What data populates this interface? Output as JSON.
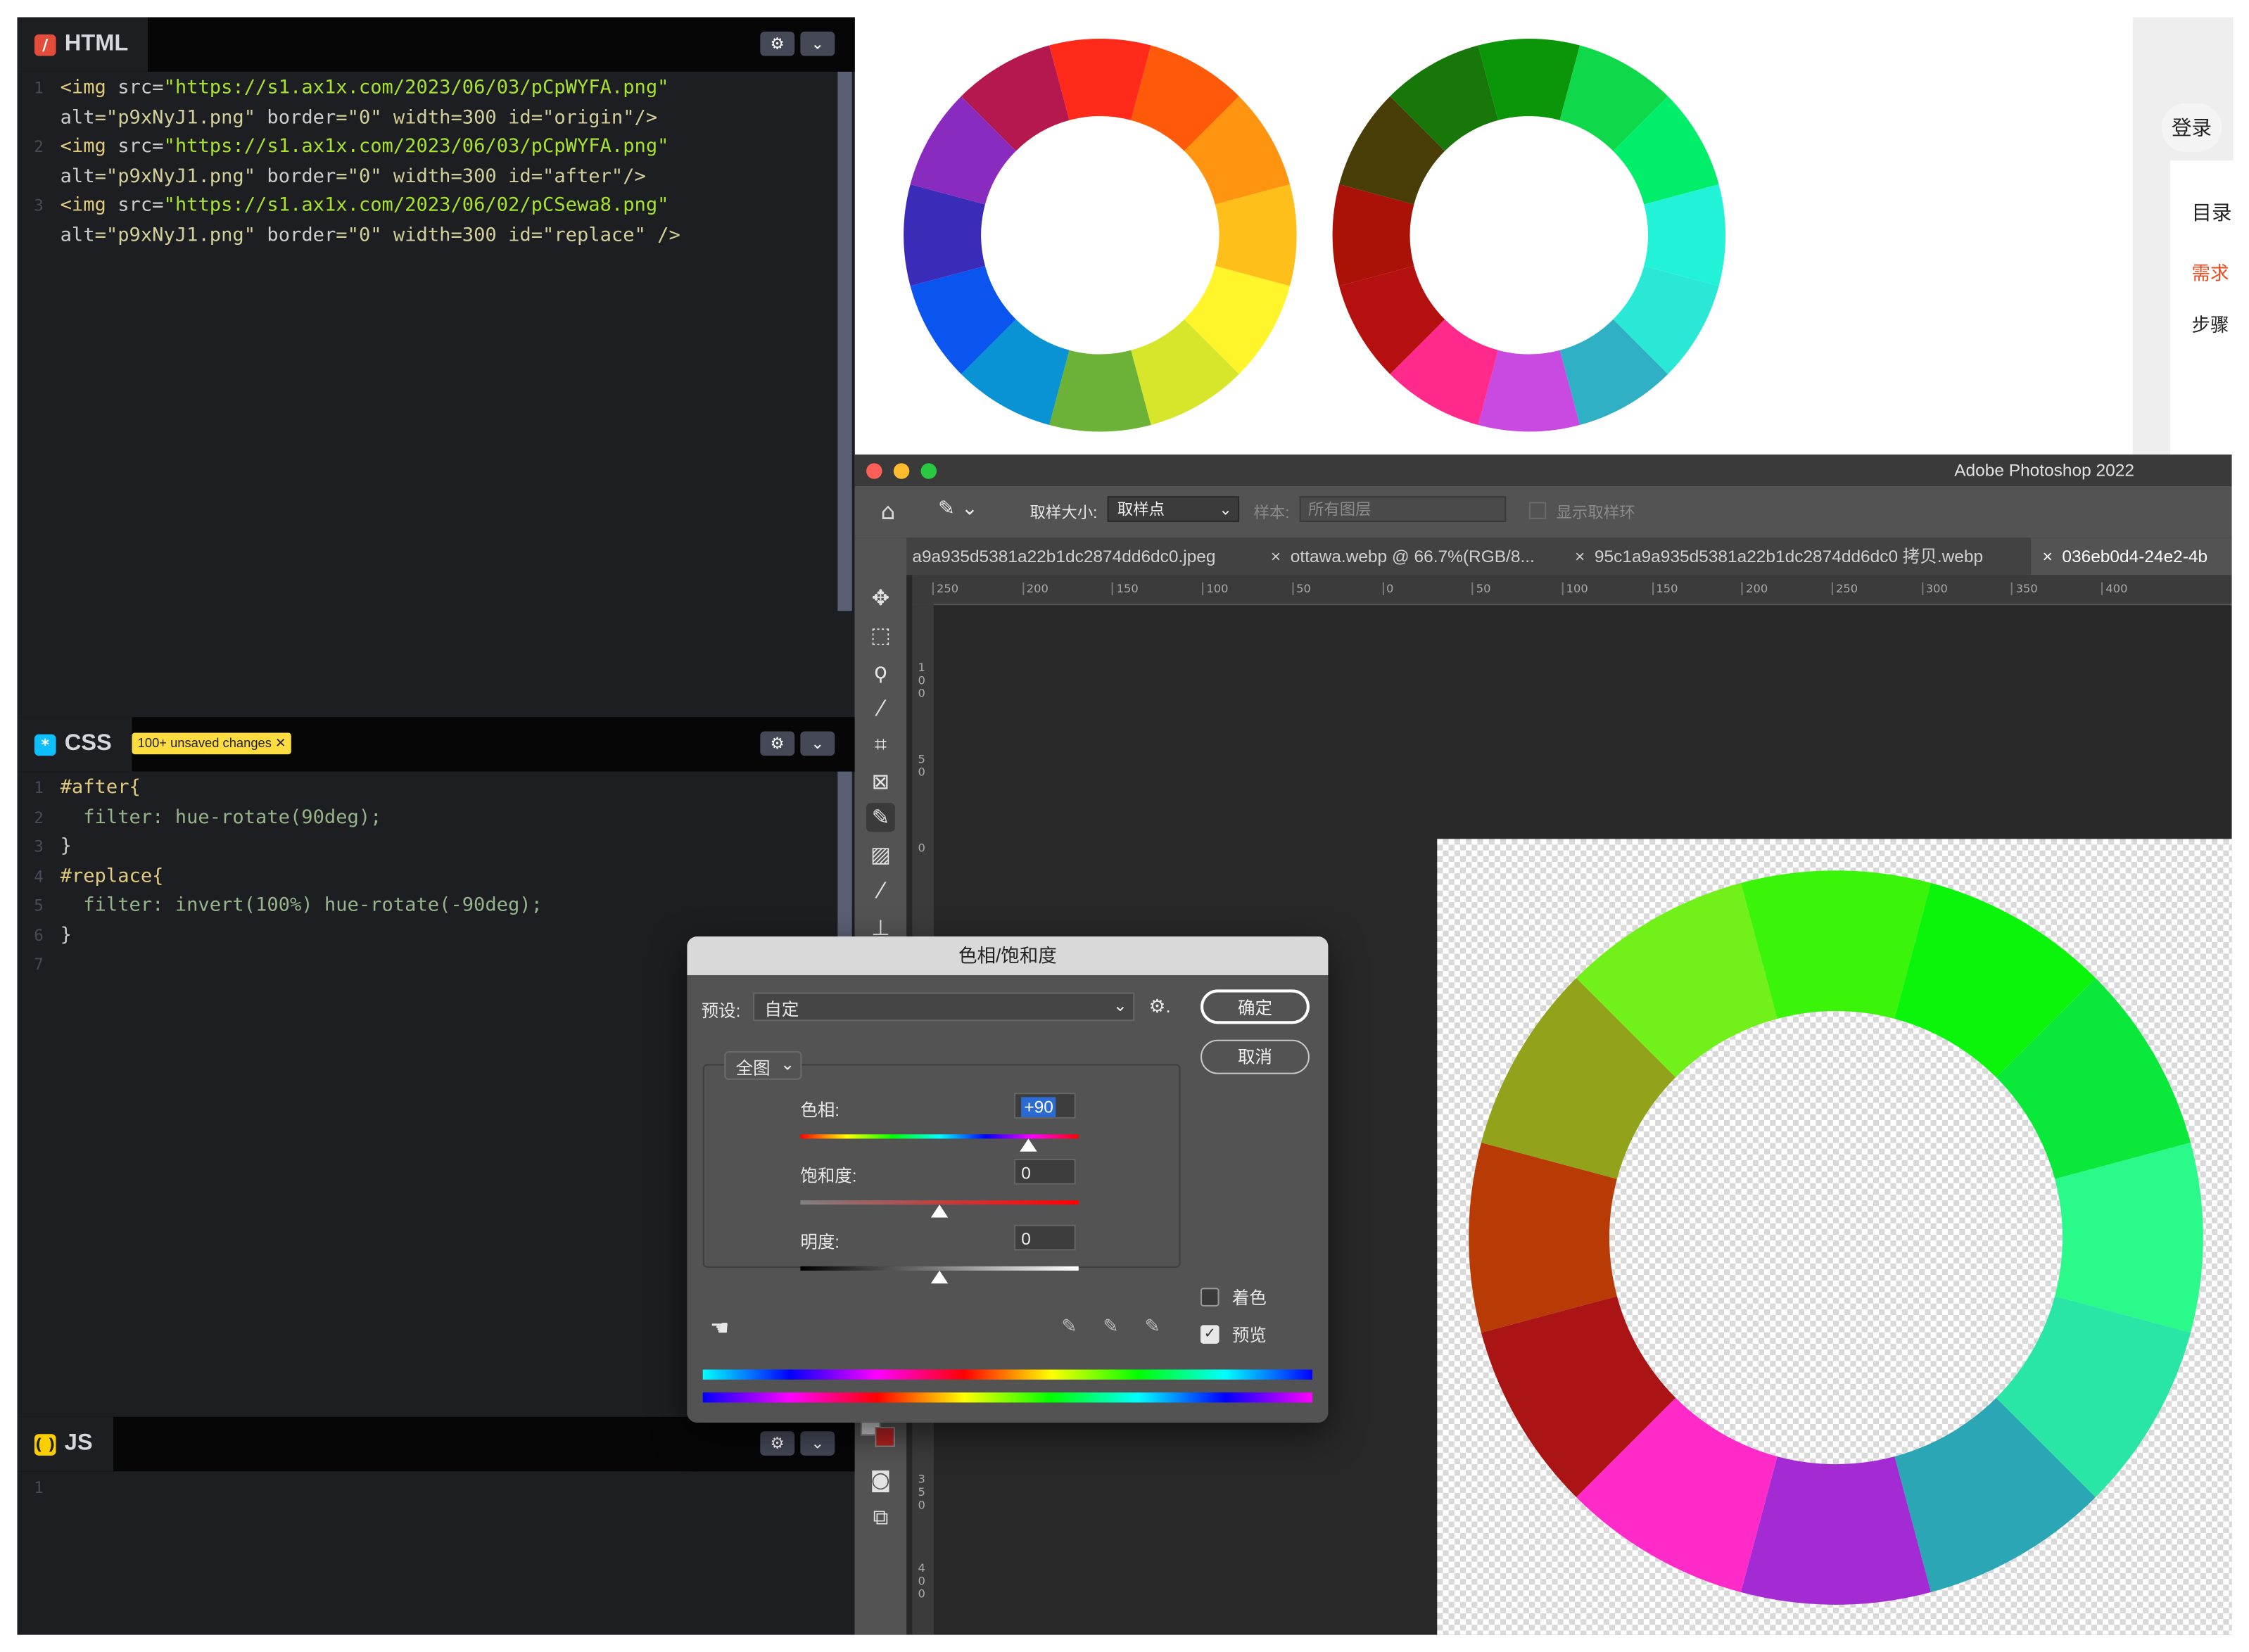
{
  "codepen": {
    "html_panel": {
      "label": "HTML",
      "line_numbers": [
        "1",
        "2",
        "3"
      ],
      "lines": [
        {
          "a": "<img ",
          "b": "src",
          "c": "=",
          "d": "\"https://s1.ax1x.com/2023/06/03/pCpWYFA.png\""
        },
        {
          "a": "alt",
          "b": "=\"p9xNyJ1.png\" ",
          "c": "border",
          "d": "=\"0\" width=300 id=\"origin\"/>"
        },
        {
          "a": "<img ",
          "b": "src",
          "c": "=",
          "d": "\"https://s1.ax1x.com/2023/06/03/pCpWYFA.png\""
        },
        {
          "a": "alt",
          "b": "=\"p9xNyJ1.png\" ",
          "c": "border",
          "d": "=\"0\" width=300 id=\"after\"/>"
        },
        {
          "a": "<img ",
          "b": "src",
          "c": "=",
          "d": "\"https://s1.ax1x.com/2023/06/02/pCSewa8.png\""
        },
        {
          "a": "alt",
          "b": "=\"p9xNyJ1.png\" ",
          "c": "border",
          "d": "=\"0\" width=300 id=\"replace\" />"
        }
      ]
    },
    "css_panel": {
      "label": "CSS",
      "badge": "100+ unsaved changes",
      "line_numbers": [
        "1",
        "2",
        "3",
        "4",
        "5",
        "6",
        "7"
      ],
      "lines": [
        "#after{",
        "  filter: hue-rotate(90deg);",
        "}",
        "#replace{",
        "  filter: invert(100%) hue-rotate(-90deg);",
        "}",
        ""
      ]
    },
    "js_panel": {
      "label": "JS",
      "line_numbers": [
        "1"
      ]
    },
    "settings_icon": "gear-icon",
    "collapse_icon": "chevron-down-icon"
  },
  "browser_sidebar": {
    "login_button": "登录",
    "toc_title": "目录",
    "toc_items": [
      "需求",
      "步骤"
    ],
    "active_color": "#e84c1e"
  },
  "photoshop": {
    "app_title": "Adobe Photoshop 2022",
    "options_bar": {
      "sample_size_label": "取样大小:",
      "sample_size_value": "取样点",
      "sample_label": "样本:",
      "sample_value": "所有图层",
      "show_ring_label": "显示取样环"
    },
    "tabs": [
      {
        "label": "a9a935d5381a22b1dc2874dd6dc0.jpeg",
        "active": false
      },
      {
        "label": "ottawa.webp @ 66.7%(RGB/8...",
        "active": false
      },
      {
        "label": "95c1a9a935d5381a22b1dc2874dd6dc0 拷贝.webp",
        "active": false
      },
      {
        "label": "036eb0d4-24e2-4b",
        "active": true
      }
    ],
    "ruler_h": [
      "250",
      "200",
      "150",
      "100",
      "50",
      "0",
      "50",
      "100",
      "150",
      "200",
      "250",
      "300",
      "350",
      "400"
    ],
    "ruler_v": [
      "100",
      "50",
      "0",
      "350",
      "400"
    ]
  },
  "hue_sat_dialog": {
    "title": "色相/饱和度",
    "preset_label": "预设:",
    "preset_value": "自定",
    "ok_label": "确定",
    "cancel_label": "取消",
    "channel_value": "全图",
    "hue_label": "色相:",
    "hue_value": "+90",
    "saturation_label": "饱和度:",
    "saturation_value": "0",
    "lightness_label": "明度:",
    "lightness_value": "0",
    "colorize_label": "着色",
    "colorize_checked": false,
    "preview_label": "预览",
    "preview_checked": true,
    "hue_slider_level": 0.82,
    "saturation_slider_level": 0.5,
    "lightness_slider_level": 0.5
  },
  "wheels": {
    "original": [
      "#ff2a1a",
      "#ff5a0a",
      "#ff9410",
      "#ffbf1a",
      "#fff52a",
      "#d7e62a",
      "#6cb236",
      "#0a93d4",
      "#0a55f0",
      "#3a2cb8",
      "#8a2bc0",
      "#b5184e"
    ],
    "after": [
      "#0a9608",
      "#0fd94a",
      "#00ee6a",
      "#22f3d8",
      "#2ae8d6",
      "#2fb0c4",
      "#c84ae0",
      "#ff2a8c",
      "#b41010",
      "#aa1208",
      "#4a3e08",
      "#177708"
    ],
    "replace": [
      "#3af50a",
      "#0af50a",
      "#0ae83a",
      "#2afa8a",
      "#2ae6a6",
      "#2aa6b4",
      "#a42ad4",
      "#ff2ac8",
      "#aa1414",
      "#b83a04",
      "#92a21a",
      "#72f01a"
    ]
  }
}
